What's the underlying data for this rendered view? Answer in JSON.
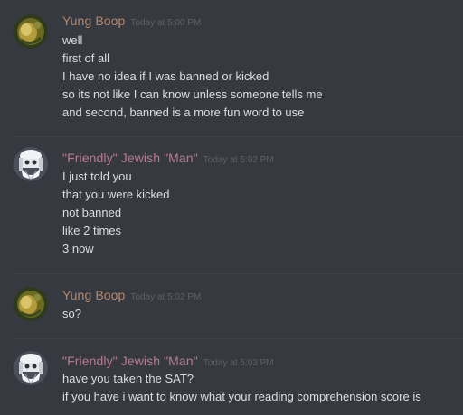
{
  "colors": {
    "background": "#36393f",
    "yung_boop_name": "#b5866d",
    "friendly_name": "#b87a93",
    "text": "#dcddde",
    "timestamp": "#5d6066"
  },
  "messages": [
    {
      "author": "Yung Boop",
      "timestamp": "Today at 5:00 PM",
      "avatar_icon": "gold-orb-avatar-icon",
      "lines": [
        "well",
        "first of all",
        "I have no idea if I was banned or kicked",
        "so its not like I can know unless someone tells me",
        "and second, banned is a more fun word to use"
      ]
    },
    {
      "author": "\"Friendly\" Jewish \"Man\"",
      "timestamp": "Today at 5:02 PM",
      "avatar_icon": "bearded-man-avatar-icon",
      "lines": [
        "I just told you",
        "that you were kicked",
        "not banned",
        "like 2 times",
        "3 now"
      ]
    },
    {
      "author": "Yung Boop",
      "timestamp": "Today at 5:02 PM",
      "avatar_icon": "gold-orb-avatar-icon",
      "lines": [
        "so?"
      ]
    },
    {
      "author": "\"Friendly\" Jewish \"Man\"",
      "timestamp": "Today at 5:03 PM",
      "avatar_icon": "bearded-man-avatar-icon",
      "lines": [
        "have you taken the SAT?",
        "if you have i want to know what your reading comprehension score is"
      ]
    }
  ]
}
